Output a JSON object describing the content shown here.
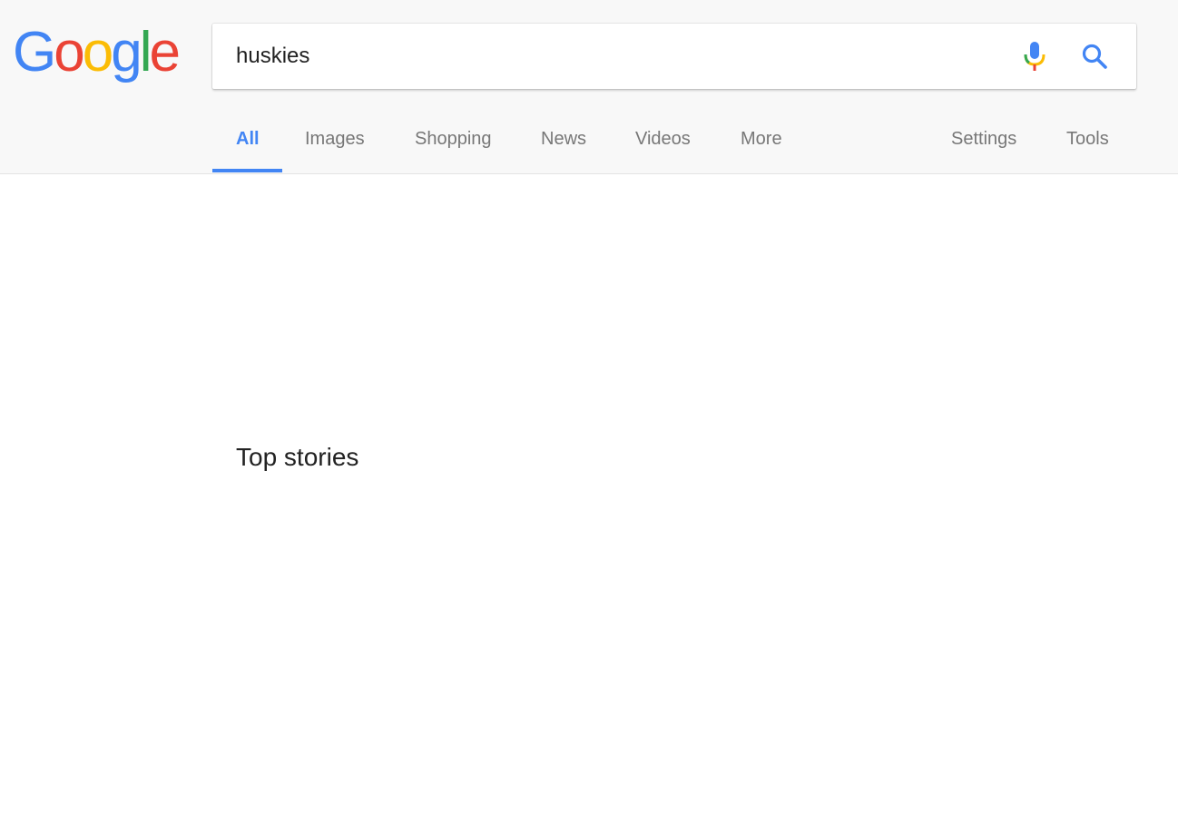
{
  "logo": {
    "letters": [
      "G",
      "o",
      "o",
      "g",
      "l",
      "e"
    ],
    "colors": [
      "#4285f4",
      "#ea4335",
      "#fbbc05",
      "#4285f4",
      "#34a853",
      "#ea4335"
    ]
  },
  "search": {
    "query": "huskies",
    "mic_icon": "microphone-icon",
    "search_icon": "magnifier-icon"
  },
  "tabs": {
    "items": [
      {
        "label": "All",
        "active": true
      },
      {
        "label": "Images",
        "active": false
      },
      {
        "label": "Shopping",
        "active": false
      },
      {
        "label": "News",
        "active": false
      },
      {
        "label": "Videos",
        "active": false
      },
      {
        "label": "More",
        "active": false
      }
    ],
    "settings_label": "Settings",
    "tools_label": "Tools",
    "active_color": "#4285f4",
    "inactive_color": "#777777"
  },
  "main": {
    "section_title": "Top stories"
  }
}
